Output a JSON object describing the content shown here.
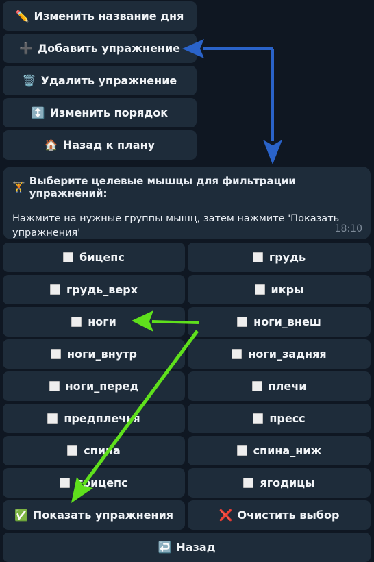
{
  "top_menu": [
    {
      "icon": "✏️",
      "label": "Изменить название дня"
    },
    {
      "icon": "➕",
      "label": "Добавить упражнение"
    },
    {
      "icon": "🗑️",
      "label": "Удалить упражнение"
    },
    {
      "icon": "↕️",
      "label": "Изменить порядок"
    },
    {
      "icon": "🏠",
      "label": "Назад к плану"
    }
  ],
  "message": {
    "icon": "🏋️",
    "title": "Выберите целевые мышцы для фильтрации упражнений:",
    "body": "Нажмите на нужные группы мышц, затем нажмите 'Показать упражнения'",
    "time": "18:10"
  },
  "muscle_buttons": [
    [
      "бицепс",
      "грудь"
    ],
    [
      "грудь_верх",
      "икры"
    ],
    [
      "ноги",
      "ноги_внеш"
    ],
    [
      "ноги_внутр",
      "ноги_задняя"
    ],
    [
      "ноги_перед",
      "плечи"
    ],
    [
      "предплечья",
      "пресс"
    ],
    [
      "спина",
      "спина_ниж"
    ],
    [
      "трицепс",
      "ягодицы"
    ]
  ],
  "actions": {
    "show": {
      "icon": "✅",
      "label": "Показать упражнения"
    },
    "clear": {
      "icon": "❌",
      "label": "Очистить выбор"
    },
    "back": {
      "icon": "↩️",
      "label": "Назад"
    }
  },
  "annotation_colors": {
    "blue": "#2a63c9",
    "green": "#5fe01c"
  }
}
